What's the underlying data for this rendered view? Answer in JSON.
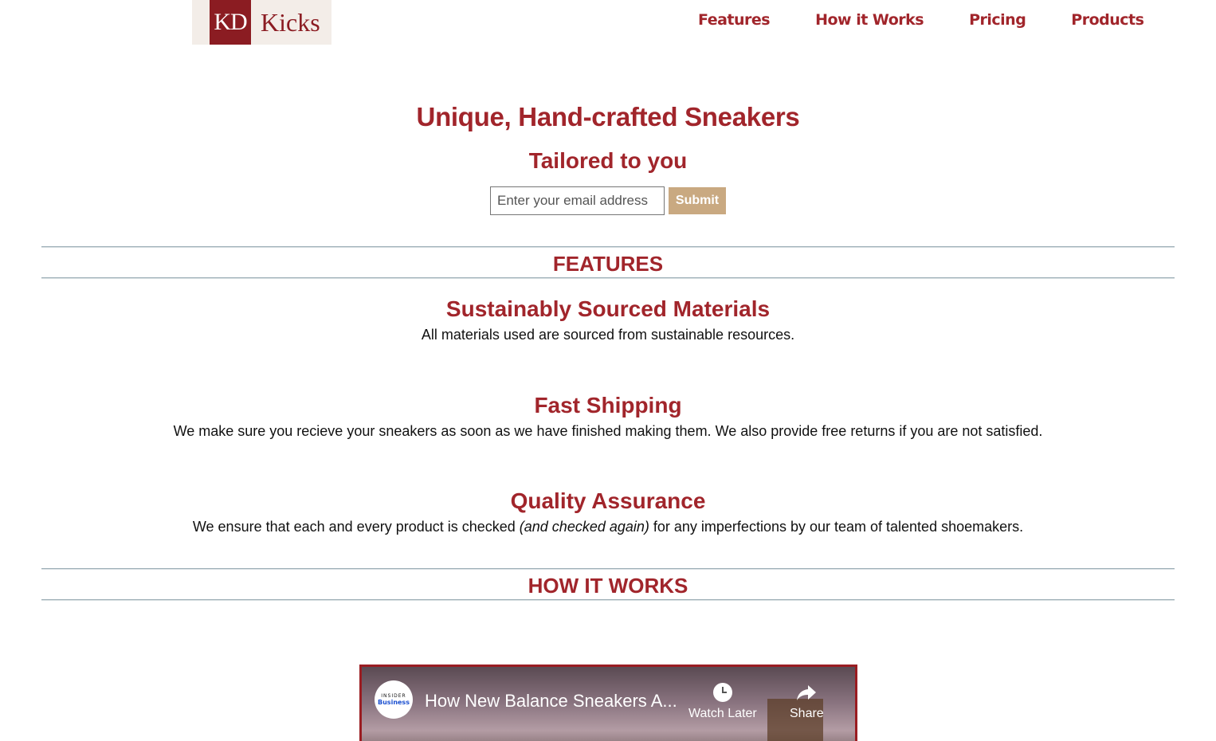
{
  "header": {
    "logo_mark": "KD",
    "logo_text": "Kicks",
    "nav": [
      "Features",
      "How it Works",
      "Pricing",
      "Products"
    ]
  },
  "hero": {
    "title": "Unique, Hand-crafted Sneakers",
    "subtitle": "Tailored to you",
    "email_placeholder": "Enter your email address",
    "submit_label": "Submit"
  },
  "features": {
    "heading": "FEATURES",
    "items": [
      {
        "title": "Sustainably Sourced Materials",
        "desc": "All materials used are sourced from sustainable resources."
      },
      {
        "title": "Fast Shipping",
        "desc": "We make sure you recieve your sneakers as soon as we have finished making them. We also provide free returns if you are not satisfied."
      },
      {
        "title": "Quality Assurance",
        "desc_before": "We ensure that each and every product is checked ",
        "desc_em": "(and checked again)",
        "desc_after": " for any imperfections by our team of talented shoemakers."
      }
    ]
  },
  "how_it_works": {
    "heading": "HOW IT WORKS",
    "video": {
      "channel_line1": "INSIDER",
      "channel_line2": "Business",
      "title": "How New Balance Sneakers A...",
      "watch_later": "Watch Later",
      "share": "Share"
    }
  },
  "colors": {
    "brand": "#a1252b",
    "submit": "#c9a981"
  }
}
